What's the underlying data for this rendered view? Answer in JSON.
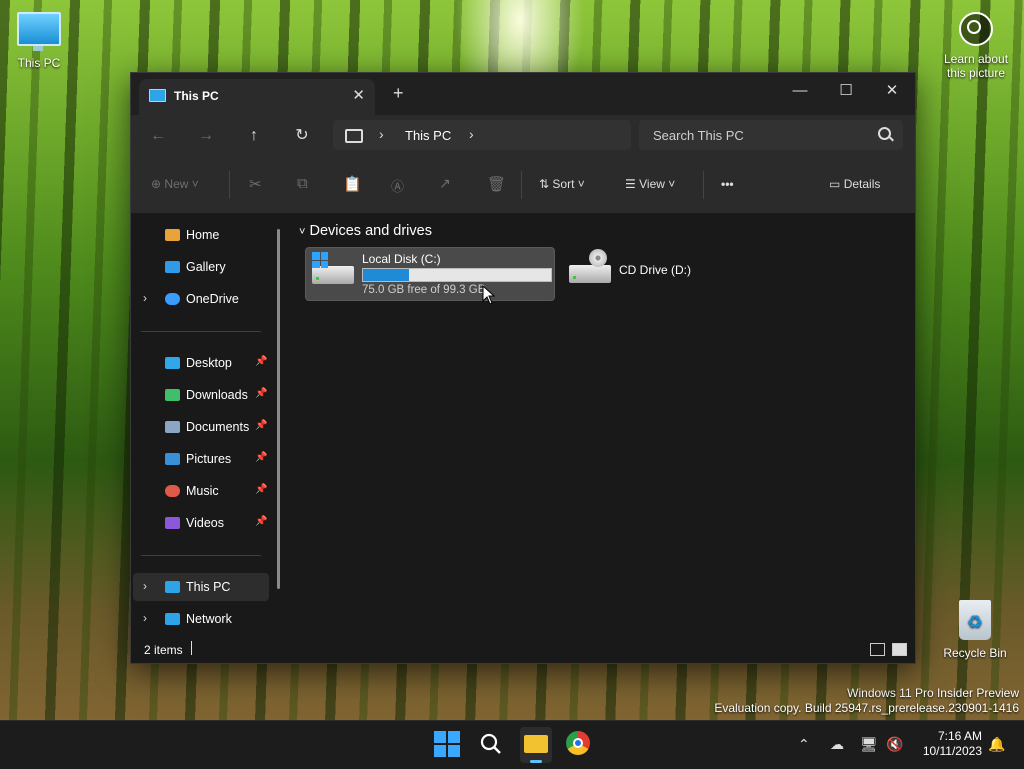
{
  "desktop": {
    "this_pc_label": "This PC",
    "recycle_bin_label": "Recycle Bin",
    "learn_line1": "Learn about",
    "learn_line2": "this picture",
    "eval_line1": "Windows 11 Pro Insider Preview",
    "eval_line2": "Evaluation copy. Build 25947.rs_prerelease.230901-1416"
  },
  "window": {
    "tab_title": "This PC",
    "tab_close": "✕",
    "new_tab": "+",
    "minimize": "—",
    "maximize": "☐",
    "close": "✕"
  },
  "nav": {
    "back": "←",
    "forward": "→",
    "up": "↑",
    "refresh": "↻",
    "breadcrumb": "This PC",
    "search_placeholder": "Search This PC"
  },
  "toolbar": {
    "new_label": "New",
    "sort_label": "Sort",
    "view_label": "View",
    "more_label": "•••",
    "details_label": "Details"
  },
  "sidebar": {
    "quick": [
      {
        "label": "Home",
        "icon": "home-icon",
        "color": "#e8a33a"
      },
      {
        "label": "Gallery",
        "icon": "gallery-icon",
        "color": "#2f9be8"
      },
      {
        "label": "OneDrive",
        "icon": "onedrive-icon",
        "color": "#3b9bff"
      }
    ],
    "pinned": [
      {
        "label": "Desktop",
        "icon": "desktop-icon",
        "color": "#2fa7e8"
      },
      {
        "label": "Downloads",
        "icon": "downloads-icon",
        "color": "#3fbf6a"
      },
      {
        "label": "Documents",
        "icon": "documents-icon",
        "color": "#8aa6c4"
      },
      {
        "label": "Pictures",
        "icon": "pictures-icon",
        "color": "#3a8fd6"
      },
      {
        "label": "Music",
        "icon": "music-icon",
        "color": "#e05a4a"
      },
      {
        "label": "Videos",
        "icon": "videos-icon",
        "color": "#8a58d8"
      }
    ],
    "locations": [
      {
        "label": "This PC",
        "icon": "this-pc-icon",
        "color": "#2ea4e8"
      },
      {
        "label": "Network",
        "icon": "network-icon",
        "color": "#2ea4e8"
      }
    ]
  },
  "content": {
    "group_header": "Devices and drives",
    "drives": [
      {
        "name": "Local Disk (C:)",
        "free_text": "75.0 GB free of 99.3 GB",
        "used_fraction": 0.245
      },
      {
        "name": "CD Drive (D:)"
      }
    ]
  },
  "status": {
    "item_count": "2 items"
  },
  "taskbar": {
    "time": "7:16 AM",
    "date": "10/11/2023"
  }
}
